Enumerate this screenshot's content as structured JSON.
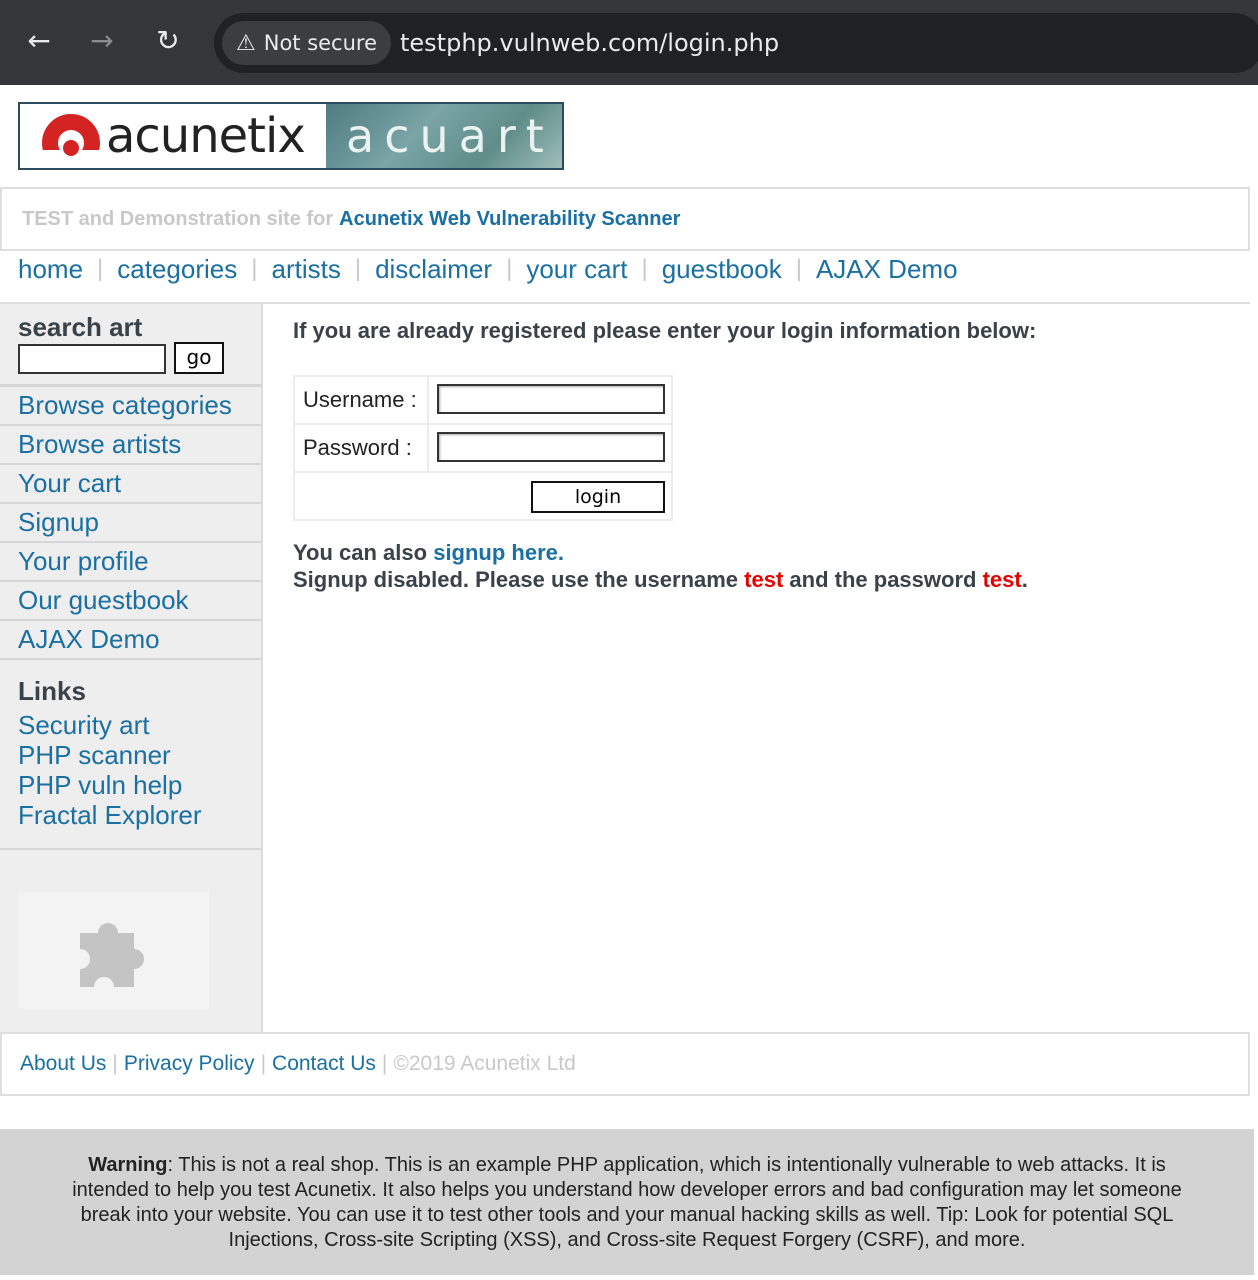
{
  "browser": {
    "security_label": "Not secure",
    "url": "testphp.vulnweb.com/login.php",
    "icons": [
      "back-icon",
      "forward-icon",
      "reload-icon",
      "warning-icon"
    ]
  },
  "logo": {
    "brand": "acunetix",
    "product": "acuart"
  },
  "tagline": {
    "prefix": "TEST and Demonstration site for",
    "brand": "Acunetix Web Vulnerability Scanner"
  },
  "topnav": [
    "home",
    "categories",
    "artists",
    "disclaimer",
    "your cart",
    "guestbook",
    "AJAX Demo"
  ],
  "topnav_separator": "|",
  "sidebar": {
    "search_title": "search art",
    "search_value": "",
    "go_label": "go",
    "menu": [
      "Browse categories",
      "Browse artists",
      "Your cart",
      "Signup",
      "Your profile",
      "Our guestbook",
      "AJAX Demo"
    ],
    "links_title": "Links",
    "links": [
      "Security art",
      "PHP scanner",
      "PHP vuln help",
      "Fractal Explorer"
    ],
    "plugin_icon": "puzzle-piece-icon"
  },
  "login": {
    "intro": "If you are already registered please enter your login information below:",
    "username_label": "Username :",
    "password_label": "Password :",
    "username_value": "",
    "password_value": "",
    "button_label": "login",
    "signup_prefix": "You can also",
    "signup_link": "signup here",
    "signup_suffix": ".",
    "disabled_prefix": "Signup disabled. Please use the username",
    "username_hint": "test",
    "disabled_middle": "and the password",
    "password_hint": "test",
    "disabled_suffix": "."
  },
  "footer": {
    "links": [
      "About Us",
      "Privacy Policy",
      "Contact Us"
    ],
    "separator": "|",
    "copyright": "©2019 Acunetix Ltd"
  },
  "warning": {
    "title": "Warning",
    "text": ": This is not a real shop. This is an example PHP application, which is intentionally vulnerable to web attacks. It is intended to help you test Acunetix. It also helps you understand how developer errors and bad configuration may let someone break into your website. You can use it to test other tools and your manual hacking skills as well. Tip: Look for potential SQL Injections, Cross-site Scripting (XSS), and Cross-site Request Forgery (CSRF), and more."
  },
  "colors": {
    "link": "#1a6fa3",
    "highlight": "#e60000",
    "heading": "#394149",
    "chrome": "#35363a",
    "warning_bg": "#d3d3d3"
  }
}
